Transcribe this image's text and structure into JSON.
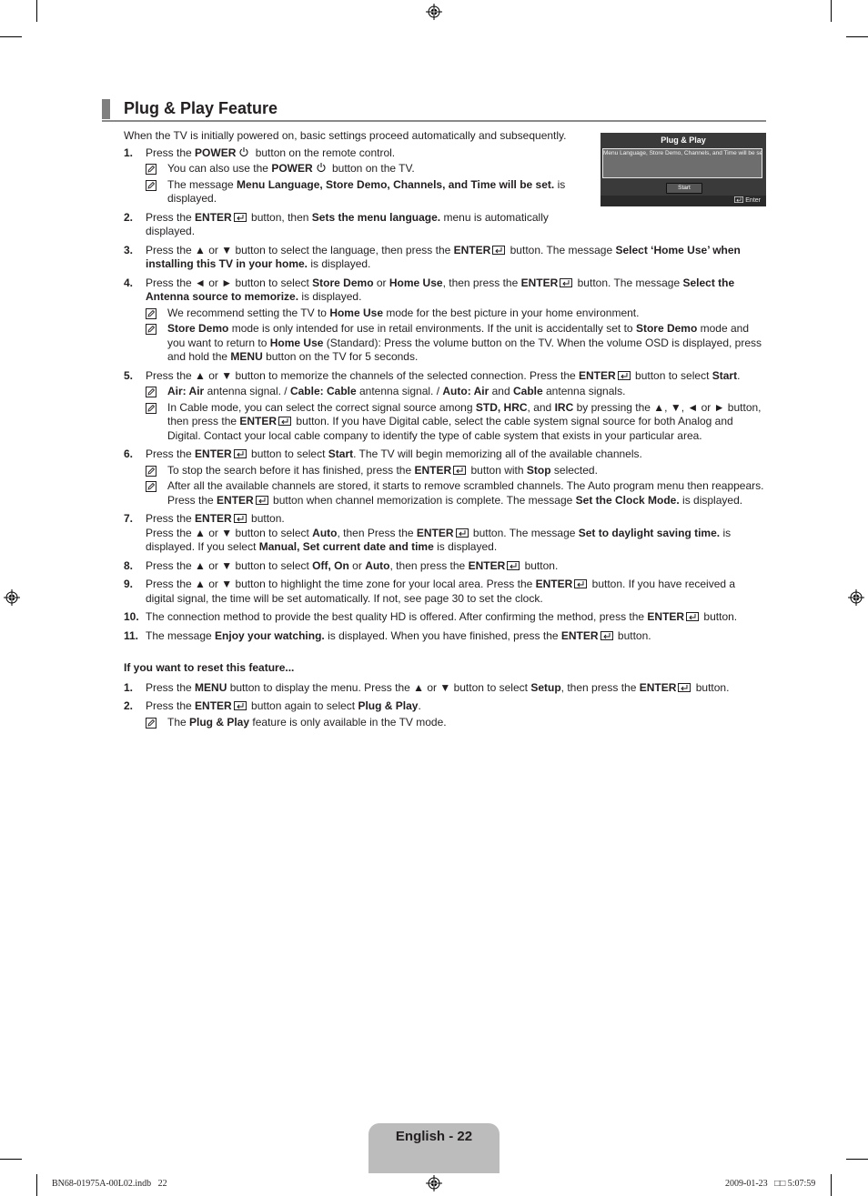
{
  "header": {
    "title": "Plug & Play Feature"
  },
  "intro": "When the TV is initially powered on, basic settings proceed automatically and subsequently.",
  "osd": {
    "title": "Plug & Play",
    "message": "Menu Language, Store Demo, Channels, and Time will be set.",
    "start_button": "Start",
    "enter_hint": "Enter"
  },
  "steps": [
    {
      "num": "1.",
      "parts": [
        "Press the ",
        "POWER",
        " button on the remote control."
      ],
      "notes": [
        [
          "You can also use the ",
          "POWER",
          " button on the TV."
        ],
        [
          "The message ",
          "Menu Language, Store Demo, Channels, and Time will be set.",
          " is displayed."
        ]
      ]
    },
    {
      "num": "2.",
      "parts": [
        "Press the ",
        "ENTER",
        " button, then ",
        "Sets the menu language.",
        " menu is automatically displayed."
      ]
    },
    {
      "num": "3.",
      "parts": [
        "Press the ▲ or ▼ button to select the language, then press the ",
        "ENTER",
        " button. The message ",
        "Select ‘Home Use’ when installing this TV in your home.",
        " is displayed."
      ]
    },
    {
      "num": "4.",
      "parts": [
        "Press the ◄ or ► button to select ",
        "Store Demo",
        " or ",
        "Home Use",
        ", then press the ",
        "ENTER",
        " button. The message ",
        "Select the Antenna source to memorize.",
        " is displayed."
      ],
      "notes": [
        [
          "We recommend setting the TV to ",
          "Home Use",
          " mode for the best picture in your home environment."
        ],
        [
          "",
          "Store Demo",
          " mode is only intended for use in retail environments. If the unit is accidentally set to ",
          "Store Demo",
          " mode and you want to return to ",
          "Home Use",
          " (Standard): Press the volume button on the TV. When the volume OSD is displayed, press and hold the ",
          "MENU",
          " button on the TV for 5 seconds."
        ]
      ]
    },
    {
      "num": "5.",
      "parts": [
        "Press the ▲ or ▼ button to memorize the channels of the selected connection. Press the ",
        "ENTER",
        " button to select ",
        "Start",
        "."
      ],
      "notes": [
        [
          "",
          "Air: Air",
          " antenna signal. / ",
          "Cable: Cable",
          " antenna signal. / ",
          "Auto: Air",
          " and ",
          "Cable",
          " antenna signals."
        ],
        [
          "In Cable mode, you can select the correct signal source among ",
          "STD, HRC",
          ", and ",
          "IRC",
          " by pressing the ▲, ▼, ◄ or ► button, then press the ",
          "ENTER",
          " button. If you have Digital cable, select the cable system signal source for both Analog and Digital. Contact your local cable company to identify the type of cable system that exists in your particular area."
        ]
      ]
    },
    {
      "num": "6.",
      "parts": [
        "Press the ",
        "ENTER",
        " button to select ",
        "Start",
        ". The TV will begin memorizing all of the available channels."
      ],
      "notes": [
        [
          "To stop the search before it has finished, press the ",
          "ENTER",
          " button with ",
          "Stop",
          " selected."
        ],
        [
          "After all the available channels are stored, it starts to remove scrambled channels. The Auto program menu then reappears. Press the ",
          "ENTER",
          " button when channel memorization is complete. The message ",
          "Set the Clock Mode.",
          " is displayed."
        ]
      ]
    },
    {
      "num": "7.",
      "parts": [
        "Press the ",
        "ENTER",
        " button."
      ],
      "continuation": [
        "Press the ▲ or ▼ button to select ",
        "Auto",
        ", then Press the ",
        "ENTER",
        " button. The message ",
        "Set to daylight saving time.",
        " is displayed. If you select ",
        "Manual, Set current date and time",
        " is displayed."
      ]
    },
    {
      "num": "8.",
      "parts": [
        "Press the ▲ or ▼ button to select ",
        "Off, On",
        " or ",
        "Auto",
        ", then press the ",
        "ENTER",
        " button."
      ]
    },
    {
      "num": "9.",
      "parts": [
        "Press the ▲ or ▼ button to highlight the time zone for your local area. Press the ",
        "ENTER",
        " button. If you have received a digital signal, the time will be set automatically. If not, see page 30 to set the clock."
      ]
    },
    {
      "num": "10.",
      "parts": [
        "The connection method to provide the best quality HD is offered. After confirming the method, press the ",
        "ENTER",
        " button."
      ]
    },
    {
      "num": "11.",
      "parts": [
        "The message ",
        "Enjoy your watching.",
        " is displayed. When you have finished, press the ",
        "ENTER",
        " button."
      ]
    }
  ],
  "reset": {
    "heading": "If you want to reset this feature...",
    "steps": [
      {
        "num": "1.",
        "parts": [
          "Press the ",
          "MENU",
          " button to display the menu. Press the ▲ or ▼ button to select ",
          "Setup",
          ", then press the ",
          "ENTER",
          " button."
        ]
      },
      {
        "num": "2.",
        "parts": [
          "Press the ",
          "ENTER",
          " button again to select ",
          "Plug & Play",
          "."
        ],
        "notes": [
          [
            "The ",
            "Plug & Play",
            " feature is only available in the TV mode."
          ]
        ]
      }
    ]
  },
  "footer": {
    "page_label": "English - 22",
    "slug_file": "BN68-01975A-00L02.indb   22",
    "slug_date": "2009-01-23   □□ 5:07:59"
  }
}
